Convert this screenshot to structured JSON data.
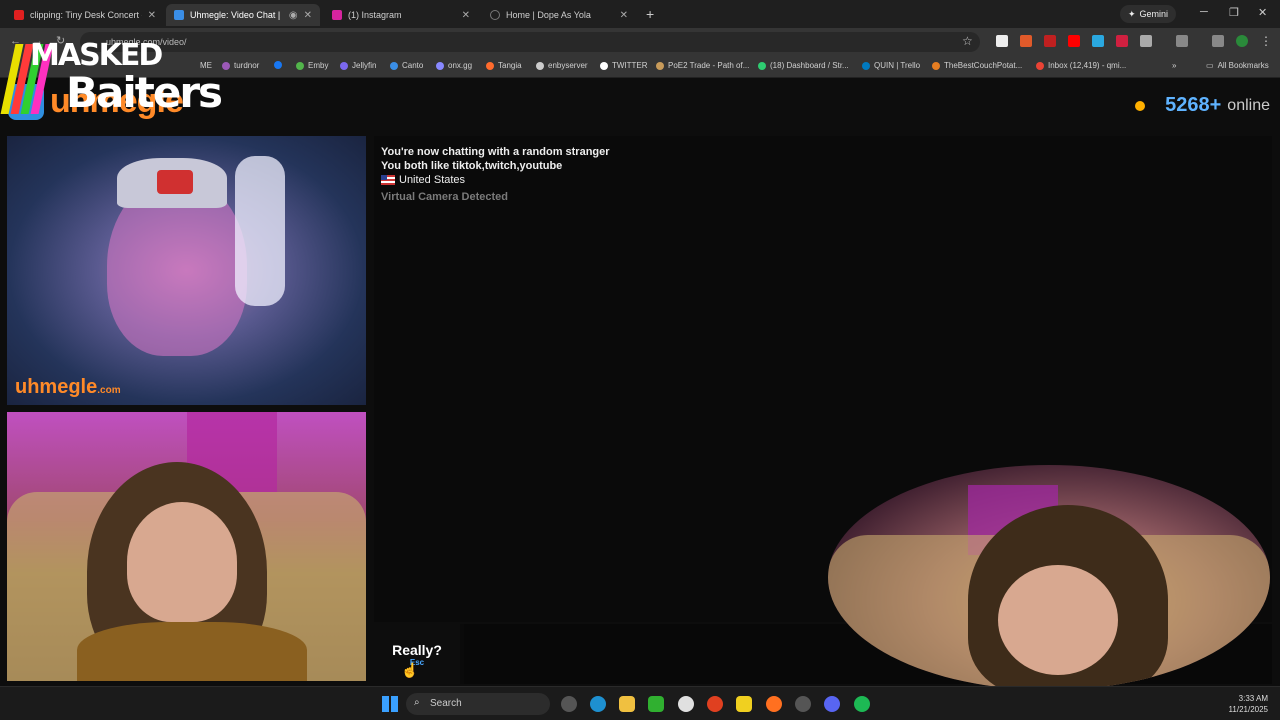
{
  "browser": {
    "tabs": [
      {
        "title": "clipping: Tiny Desk Concert - Y",
        "color": "#e02020",
        "active": false
      },
      {
        "title": "Uhmegle: Video Chat | Ran",
        "color": "#3a8ee6",
        "active": true
      },
      {
        "title": "(1) Instagram",
        "color": "#d6249f",
        "active": false
      },
      {
        "title": "Home | Dope As Yola",
        "color": "#555555",
        "active": false
      }
    ],
    "new_tab": "+",
    "gemini_label": "Gemini",
    "url": "uhmegle.com/video/",
    "bookmarks": [
      {
        "label": "ME",
        "color": "#4caf50"
      },
      {
        "label": "turdnor",
        "color": "#9b59b6"
      },
      {
        "label": "",
        "color": "#1877f2"
      },
      {
        "label": "Emby",
        "color": "#52b54b"
      },
      {
        "label": "Jellyfin",
        "color": "#7b68ee"
      },
      {
        "label": "Canto",
        "color": "#3a8ee6"
      },
      {
        "label": "onx.gg",
        "color": "#8888ff"
      },
      {
        "label": "Tangia",
        "color": "#ff6b2d"
      },
      {
        "label": "enbyserver",
        "color": "#cccccc"
      },
      {
        "label": "TWITTER",
        "color": "#ffffff"
      },
      {
        "label": "PoE2 Trade - Path of...",
        "color": "#c89b5a"
      },
      {
        "label": "(18) Dashboard / Str...",
        "color": "#2ecc71"
      },
      {
        "label": "QUIN | Trello",
        "color": "#0079bf"
      },
      {
        "label": "TheBestCouchPotat...",
        "color": "#e67e22"
      },
      {
        "label": "Inbox (12,419) - qmi...",
        "color": "#ea4335"
      }
    ],
    "all_bookmarks": "All Bookmarks"
  },
  "site": {
    "logo": "uhmegle",
    "online_count": "5268+",
    "online_label": "online",
    "watermark": "uhmegle",
    "watermark_suffix": ".com"
  },
  "overlay": {
    "line1": "MASKED",
    "line2": "Baiters"
  },
  "chat": {
    "messages": [
      {
        "text": "You're now chatting with a random stranger",
        "style": "bold"
      },
      {
        "text": "You both like tiktok,twitch,youtube",
        "style": "bold"
      },
      {
        "text": "United States",
        "style": "plain"
      },
      {
        "text": "Virtual Camera Detected",
        "style": "dim"
      }
    ]
  },
  "controls": {
    "skip_label": "Really?",
    "skip_hint": "Esc"
  },
  "taskbar": {
    "search_placeholder": "Search",
    "time": "3:33 AM",
    "date": "11/21/2025"
  }
}
